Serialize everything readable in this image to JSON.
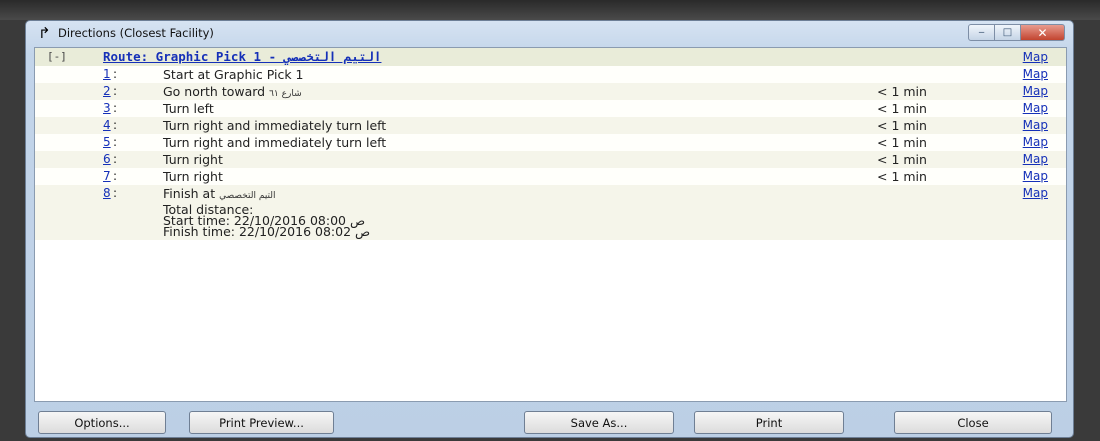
{
  "window": {
    "title": "Directions (Closest Facility)",
    "controls": [
      "minimize",
      "maximize",
      "close"
    ]
  },
  "route": {
    "toggle": "[-]",
    "title": "Route: Graphic Pick 1 - التيم التخصصي",
    "map_label": "Map"
  },
  "steps": [
    {
      "num": "1",
      "text": "Start at Graphic Pick 1",
      "arabic": "",
      "time": "",
      "map": "Map"
    },
    {
      "num": "2",
      "text": "Go north toward",
      "arabic": "شارع ٦١",
      "time": "< 1 min",
      "map": "Map"
    },
    {
      "num": "3",
      "text": "Turn left",
      "arabic": "",
      "time": "< 1 min",
      "map": "Map"
    },
    {
      "num": "4",
      "text": "Turn right and immediately turn left",
      "arabic": "",
      "time": "< 1 min",
      "map": "Map"
    },
    {
      "num": "5",
      "text": "Turn right and immediately turn left",
      "arabic": "",
      "time": "< 1 min",
      "map": "Map"
    },
    {
      "num": "6",
      "text": "Turn right",
      "arabic": "",
      "time": "< 1 min",
      "map": "Map"
    },
    {
      "num": "7",
      "text": "Turn right",
      "arabic": "",
      "time": "< 1 min",
      "map": "Map"
    },
    {
      "num": "8",
      "text": "Finish at",
      "arabic": "التيم التخصصي",
      "time": "",
      "map": "Map"
    }
  ],
  "summary": {
    "total_distance": "Total distance:",
    "start_time": "Start time: 22/10/2016 08:00 ص",
    "finish_time": "Finish time: 22/10/2016 08:02 ص"
  },
  "buttons": {
    "options": "Options...",
    "print_preview": "Print Preview...",
    "save_as": "Save As...",
    "print": "Print",
    "close": "Close"
  },
  "colors": {
    "link": "#1530b8",
    "header_bg": "#e9ecd9",
    "row_alt_bg": "#f5f5ea",
    "chrome": "#c3d5ea",
    "close_button": "#c2442f"
  },
  "icons": {
    "title": "directions-arrow-icon",
    "minimize": "minimize-icon",
    "maximize": "maximize-icon",
    "close": "close-icon"
  }
}
